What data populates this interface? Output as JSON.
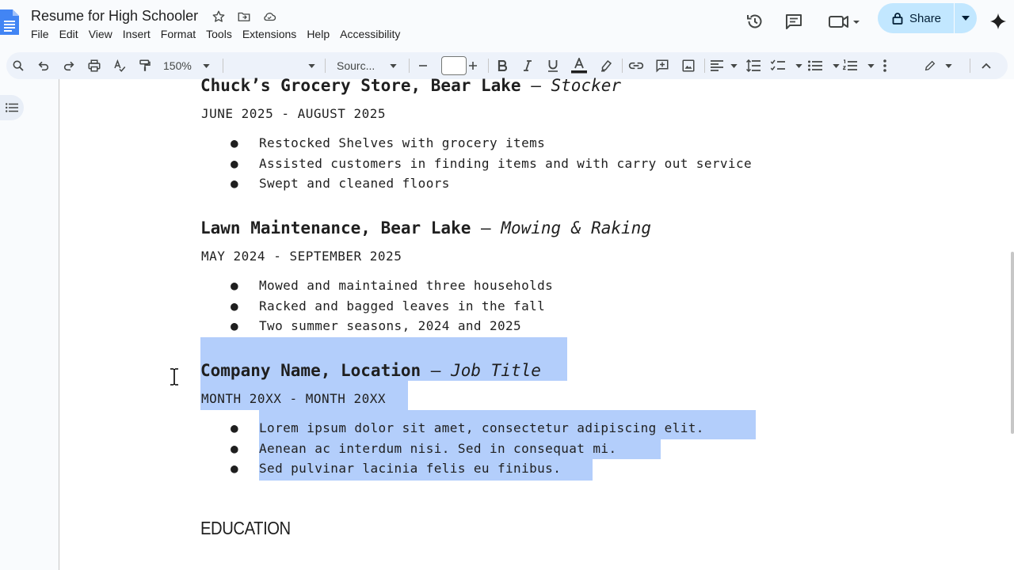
{
  "doc": {
    "title": "Resume for High Schooler"
  },
  "menu": [
    "File",
    "Edit",
    "View",
    "Insert",
    "Format",
    "Tools",
    "Extensions",
    "Help",
    "Accessibility"
  ],
  "share": {
    "label": "Share"
  },
  "toolbar": {
    "zoom": "150%",
    "style": "",
    "font": "Sourc...",
    "font_size": ""
  },
  "content": {
    "jobs": [
      {
        "company": "Chuck’s Grocery Store, Bear Lake",
        "dash": " — ",
        "role": "Stocker",
        "dates": "JUNE 2025 - AUGUST 2025",
        "bullets": [
          "Restocked Shelves with grocery items",
          "Assisted customers in finding items and with carry out service",
          "Swept and cleaned floors"
        ]
      },
      {
        "company": "Lawn Maintenance, Bear Lake",
        "dash": " — ",
        "role": "Mowing & Raking",
        "dates": "MAY 2024 - SEPTEMBER 2025",
        "bullets": [
          "Mowed and maintained three households",
          "Racked and bagged leaves in the fall",
          "Two summer seasons, 2024 and 2025"
        ]
      },
      {
        "company": "Company Name, Location",
        "dash": " — ",
        "role": "Job Title",
        "dates": "MONTH 20XX - MONTH 20XX",
        "bullets": [
          "Lorem ipsum dolor sit amet, consectetur adipiscing elit.",
          "Aenean ac interdum nisi. Sed in consequat mi.",
          "Sed pulvinar lacinia felis eu finibus."
        ]
      }
    ],
    "section_heading": "EDUCATION"
  },
  "bullet_char": "●",
  "colors": {
    "selection": "#b3cefb",
    "share_bg": "#c2e7ff",
    "toolbar_bg": "#edf2fa",
    "docs_blue": "#4285f4"
  }
}
